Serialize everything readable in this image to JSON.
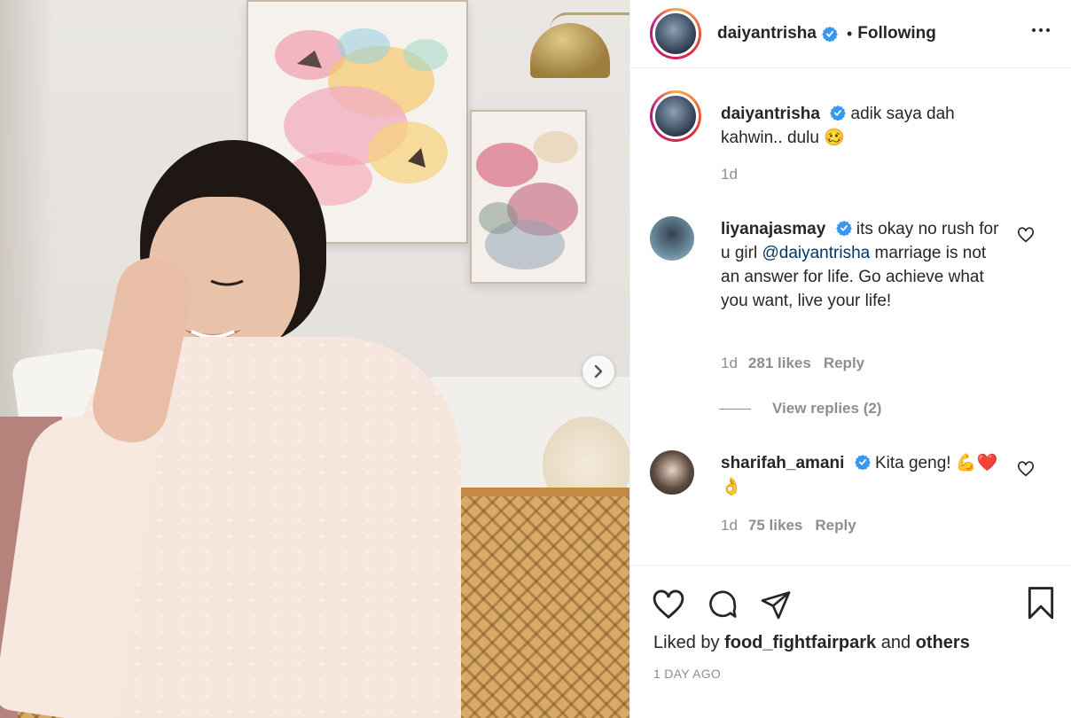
{
  "post": {
    "username": "daiyantrisha",
    "following_label": "Following",
    "separator": "•"
  },
  "caption": {
    "username": "daiyantrisha",
    "text": "adik saya dah kahwin.. dulu 🥴",
    "age": "1d"
  },
  "comments": [
    {
      "username": "liyanajasmay",
      "text_before": "its okay no rush for u girl ",
      "mention": "@daiyantrisha",
      "text_after": " marriage is not an answer for life. Go achieve what you want, live your life!",
      "age": "1d",
      "likes": "281 likes",
      "reply_label": "Reply",
      "view_replies": "View replies (2)"
    },
    {
      "username": "sharifah_amani",
      "text": "Kita geng! 💪❤️👌",
      "age": "1d",
      "likes": "75 likes",
      "reply_label": "Reply"
    }
  ],
  "footer": {
    "liked_by_prefix": "Liked by",
    "liked_by_user": "food_fightfairpark",
    "liked_by_and": "and",
    "liked_by_others": "others",
    "timestamp": "1 DAY AGO"
  },
  "colors": {
    "verified_blue": "#3897f0",
    "text": "#262626",
    "muted": "#8e8e8e",
    "mention": "#00376b"
  }
}
